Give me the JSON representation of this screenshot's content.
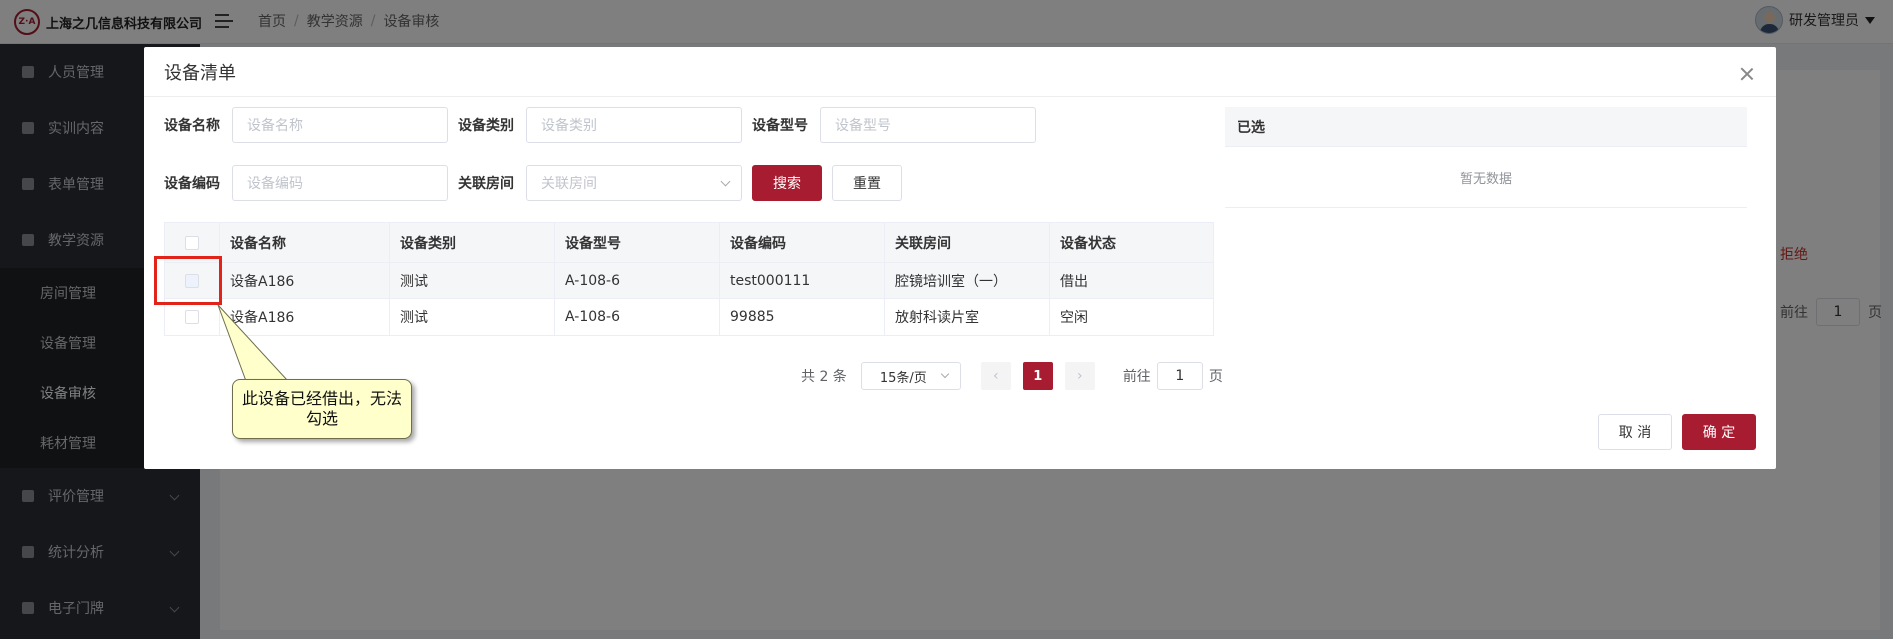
{
  "app": {
    "logo_mark": "Z·A",
    "company": "上海之几信息科技有限公司"
  },
  "breadcrumb": [
    "首页",
    "教学资源",
    "设备审核"
  ],
  "user": {
    "name": "研发管理员"
  },
  "sidebar": {
    "items": [
      {
        "label": "人员管理",
        "icon": "user-icon"
      },
      {
        "label": "实训内容",
        "icon": "content-icon"
      },
      {
        "label": "表单管理",
        "icon": "form-icon"
      },
      {
        "label": "教学资源",
        "icon": "resource-icon"
      }
    ],
    "sub_items": [
      {
        "label": "房间管理"
      },
      {
        "label": "设备管理"
      },
      {
        "label": "设备审核",
        "active": true
      },
      {
        "label": "耗材管理"
      }
    ],
    "bottom_items": [
      {
        "label": "评价管理",
        "icon": "review-icon"
      },
      {
        "label": "统计分析",
        "icon": "chart-icon"
      },
      {
        "label": "电子门牌",
        "icon": "doorplate-icon"
      }
    ]
  },
  "background": {
    "refuse_label": "拒绝",
    "goto_label": "前往",
    "goto_page": "1",
    "page_unit": "页"
  },
  "modal": {
    "title": "设备清单",
    "filters": {
      "name": {
        "label": "设备名称",
        "placeholder": "设备名称"
      },
      "category": {
        "label": "设备类别",
        "placeholder": "设备类别"
      },
      "model": {
        "label": "设备型号",
        "placeholder": "设备型号"
      },
      "code": {
        "label": "设备编码",
        "placeholder": "设备编码"
      },
      "room": {
        "label": "关联房间",
        "placeholder": "关联房间"
      }
    },
    "search_label": "搜索",
    "reset_label": "重置",
    "table": {
      "headers": [
        "设备名称",
        "设备类别",
        "设备型号",
        "设备编码",
        "关联房间",
        "设备状态"
      ],
      "rows": [
        [
          "设备A186",
          "测试",
          "A-108-6",
          "test000111",
          "腔镜培训室（一）",
          "借出"
        ],
        [
          "设备A186",
          "测试",
          "A-108-6",
          "99885",
          "放射科读片室",
          "空闲"
        ]
      ]
    },
    "pagination": {
      "total_label": "共 2 条",
      "page_size": "15条/页",
      "current_page": "1",
      "prev": "‹",
      "next": "›",
      "goto_label": "前往",
      "goto_value": "1",
      "page_unit": "页"
    },
    "selected": {
      "title": "已选",
      "empty": "暂无数据"
    },
    "cancel_label": "取 消",
    "confirm_label": "确 定"
  },
  "annotation": {
    "text": "此设备已经借出，无法勾选"
  },
  "colors": {
    "brand": "#a81c31",
    "highlight": "#e2231a",
    "callout_bg": "#ffffcc"
  }
}
